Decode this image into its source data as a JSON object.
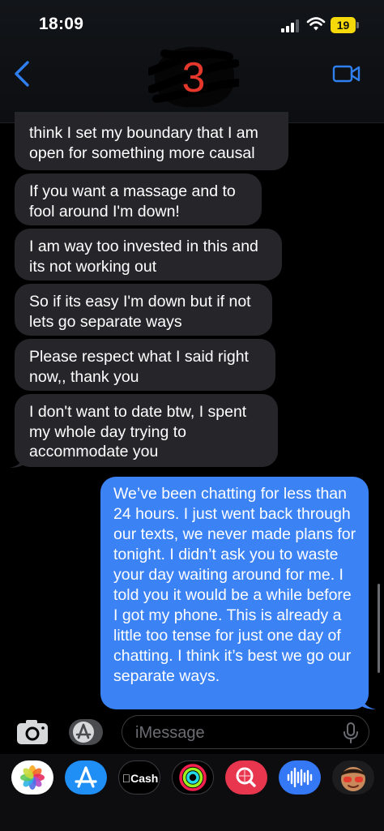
{
  "status_bar": {
    "time": "18:09",
    "battery": "19"
  },
  "header": {
    "contact_initial": "3"
  },
  "messages": [
    {
      "from": "them",
      "text": "think I set my boundary that I am open for something more causal"
    },
    {
      "from": "them",
      "text": "If you want a massage and to fool around I'm down!"
    },
    {
      "from": "them",
      "text": "I am way too invested in this and its not working out"
    },
    {
      "from": "them",
      "text": "So if its easy I'm down but if not lets go separate ways"
    },
    {
      "from": "them",
      "text": "Please respect what I said right now,, thank you"
    },
    {
      "from": "them",
      "text": "I don't want to date btw, I spent my whole day trying to accommodate you"
    },
    {
      "from": "me",
      "text": "We’ve been chatting for less than 24 hours. I just went back through our texts, we never made plans for tonight. I didn’t ask you to waste your day waiting around for me. I told you it would be a while before I got my phone. This is already a little too tense for just one day of chatting. I think it’s best we go our separate ways."
    }
  ],
  "composer": {
    "placeholder": "iMessage"
  },
  "app_drawer": {
    "apps": [
      {
        "name": "photos-icon"
      },
      {
        "name": "app-store-icon"
      },
      {
        "name": "apple-cash-icon",
        "label": "Cash"
      },
      {
        "name": "activity-icon"
      },
      {
        "name": "image-search-icon"
      },
      {
        "name": "audio-message-icon"
      },
      {
        "name": "memoji-icon"
      }
    ]
  },
  "colors": {
    "sent_bubble": "#3b82f4",
    "received_bubble": "#26262a",
    "accent": "#2f7ff0"
  }
}
